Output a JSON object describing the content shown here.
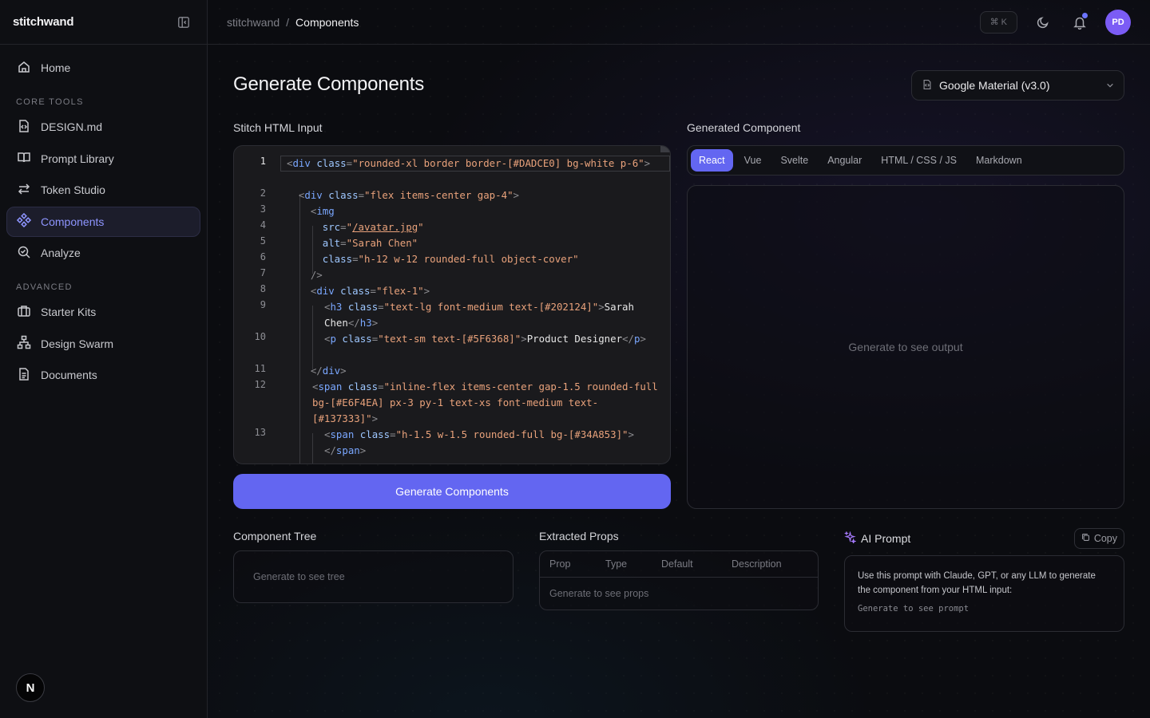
{
  "app": {
    "brand": "stitchwand",
    "footer_logo": "N"
  },
  "breadcrumb": {
    "root": "stitchwand",
    "separator": "/",
    "current": "Components"
  },
  "topbar": {
    "shortcut": "⌘ K",
    "avatar_initials": "PD"
  },
  "sidebar": {
    "home": "Home",
    "section_core": "CORE TOOLS",
    "core_items": [
      {
        "label": "DESIGN.md",
        "icon": "file-code-icon"
      },
      {
        "label": "Prompt Library",
        "icon": "book-icon"
      },
      {
        "label": "Token Studio",
        "icon": "arrows-swap-icon"
      },
      {
        "label": "Components",
        "icon": "components-icon",
        "active": true
      },
      {
        "label": "Analyze",
        "icon": "search-check-icon"
      }
    ],
    "section_advanced": "ADVANCED",
    "advanced_items": [
      {
        "label": "Starter Kits",
        "icon": "briefcase-icon"
      },
      {
        "label": "Design Swarm",
        "icon": "network-icon"
      },
      {
        "label": "Documents",
        "icon": "document-icon"
      }
    ]
  },
  "main": {
    "title": "Generate Components",
    "design_system": "Google Material (v3.0)",
    "input_label": "Stitch HTML Input",
    "generate_button": "Generate Components",
    "output_label": "Generated Component",
    "output_empty": "Generate to see output",
    "tabs": [
      "React",
      "Vue",
      "Svelte",
      "Angular",
      "HTML / CSS / JS",
      "Markdown"
    ],
    "active_tab": "React"
  },
  "editor": {
    "line_numbers": [
      "1",
      "2",
      "3",
      "4",
      "5",
      "6",
      "7",
      "8",
      "9",
      "10",
      "11",
      "12",
      "13"
    ],
    "current_line": "1"
  },
  "tree": {
    "label": "Component Tree",
    "empty": "Generate to see tree"
  },
  "props": {
    "label": "Extracted Props",
    "columns": [
      "Prop",
      "Type",
      "Default",
      "Description"
    ],
    "empty": "Generate to see props"
  },
  "ai_prompt": {
    "label": "AI Prompt",
    "copy": "Copy",
    "description": "Use this prompt with Claude, GPT, or any LLM to generate the component from your HTML input:",
    "empty": "Generate to see prompt"
  },
  "colors": {
    "accent": "#6366f1",
    "active_nav_text": "#8e95ff",
    "avatar": "#7b5cf5"
  }
}
